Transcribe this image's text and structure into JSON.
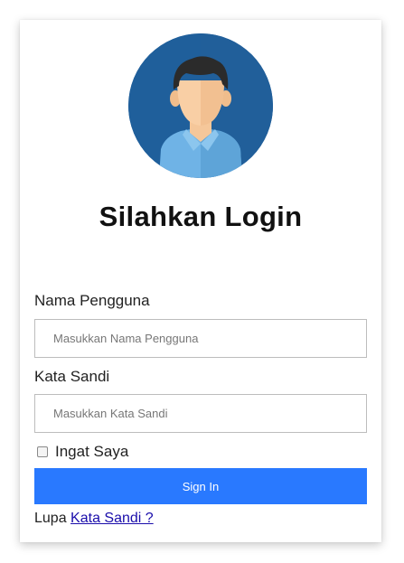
{
  "login": {
    "avatar_icon": "user-avatar-icon",
    "title": "Silahkan Login",
    "username_label": "Nama Pengguna",
    "username_placeholder": "Masukkan Nama Pengguna",
    "password_label": "Kata Sandi",
    "password_placeholder": "Masukkan Kata Sandi",
    "remember_label": "Ingat Saya",
    "remember_checked": false,
    "signin_label": "Sign In",
    "forgot_prefix": "Lupa",
    "forgot_link": "Kata Sandi ?"
  },
  "colors": {
    "primary_button": "#2979ff",
    "avatar_background": "#1f5f9b",
    "link": "#1a0dab"
  }
}
